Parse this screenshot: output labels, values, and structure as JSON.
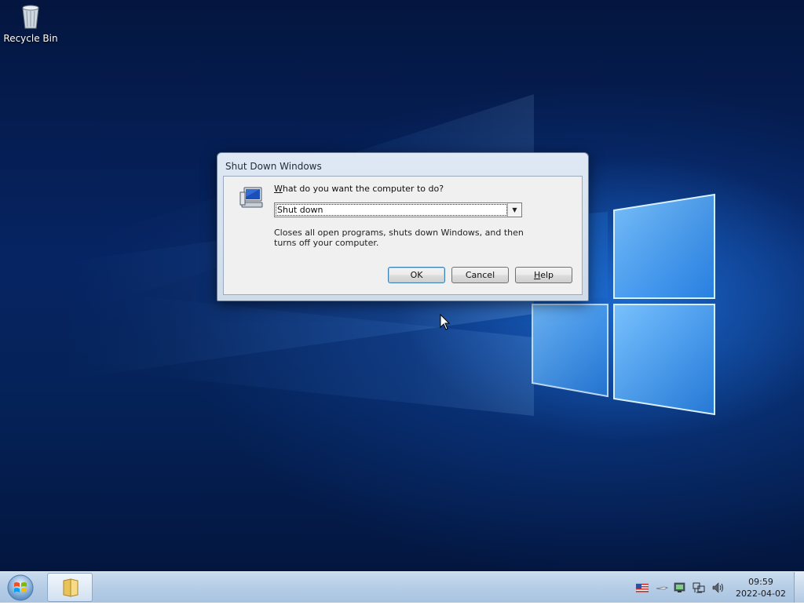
{
  "desktop": {
    "icons": [
      {
        "label": "Recycle Bin",
        "icon": "recycle-bin-icon"
      }
    ]
  },
  "dialog": {
    "title": "Shut Down Windows",
    "prompt": "What do you want the computer to do?",
    "prompt_access_key": "W",
    "selected_option": "Shut down",
    "description": "Closes all open programs, shuts down Windows, and then turns off your computer.",
    "buttons": {
      "ok": "OK",
      "cancel": "Cancel",
      "help": "Help"
    }
  },
  "taskbar": {
    "start_icon": "windows-orb-icon",
    "pinned": [
      {
        "icon": "folder-icon",
        "name": "Windows Explorer"
      }
    ],
    "tray_icons": [
      "us-flag-icon",
      "usb-icon",
      "monitor-status-icon",
      "network-icon",
      "volume-icon"
    ],
    "clock": {
      "time": "09:59",
      "date": "2022-04-02"
    }
  },
  "colors": {
    "desktop_bg": "#062463",
    "accent_light": "#8fd0ff",
    "dialog_frame": "#dfe9f5",
    "taskbar_bg": "#b6cde6"
  }
}
